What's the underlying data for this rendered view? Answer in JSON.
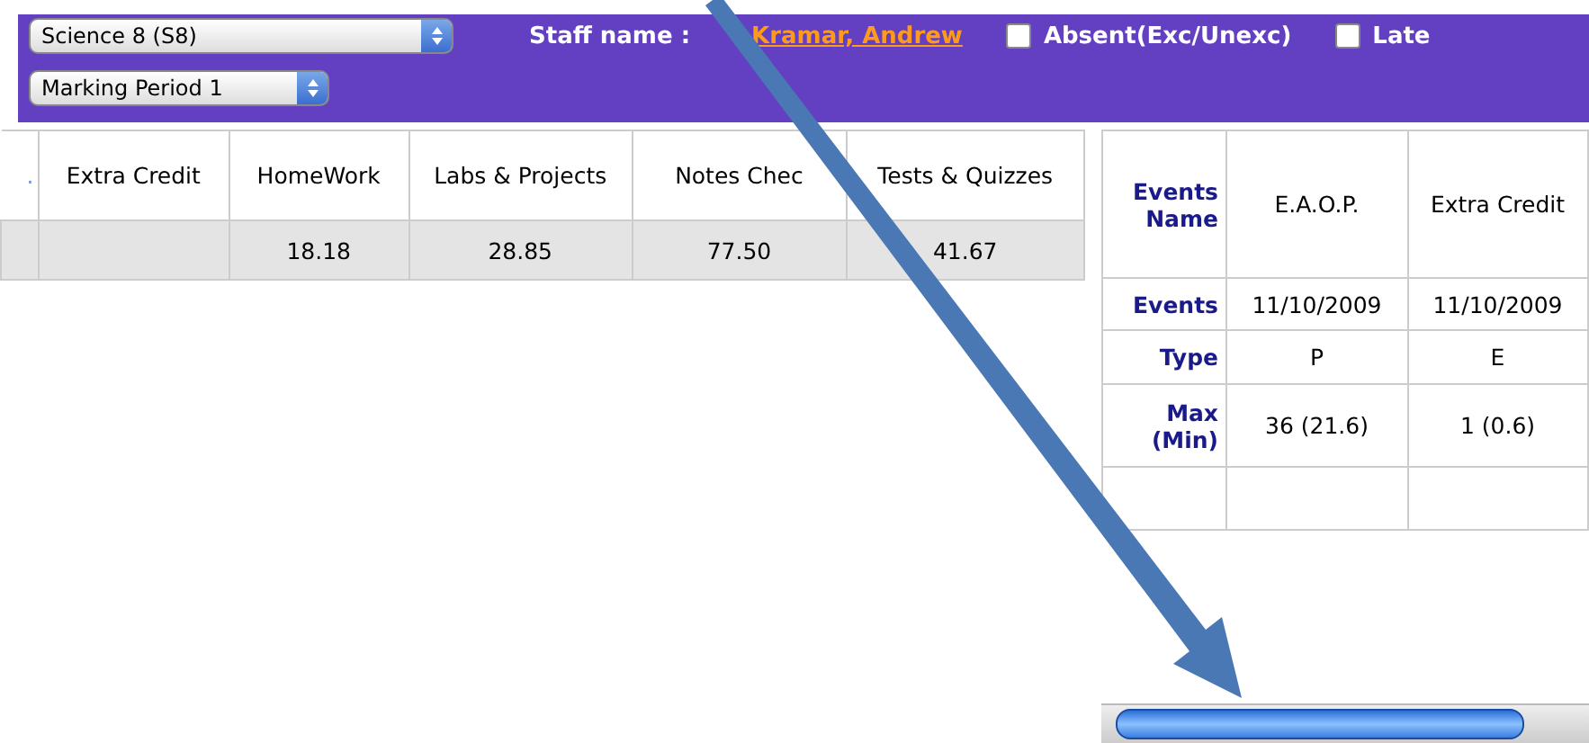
{
  "toolbar": {
    "course_select": {
      "value": "Science 8 (S8)"
    },
    "period_select": {
      "value": "Marking Period 1"
    },
    "staff_label": "Staff name :",
    "staff_name": "Kramar, Andrew",
    "checkboxes": [
      {
        "label": "Absent(Exc/Unexc)",
        "checked": false
      },
      {
        "label": "Late",
        "checked": false
      }
    ]
  },
  "scores_table": {
    "columns": [
      ".",
      "Extra Credit",
      "HomeWork",
      "Labs & Projects",
      "Notes Chec",
      "Tests & Quizzes"
    ],
    "rows": [
      [
        "",
        "",
        "18.18",
        "28.85",
        "77.50",
        "41.67"
      ]
    ]
  },
  "events_table": {
    "row_labels": [
      "Events Name",
      "Events",
      "Type",
      "Max (Min)"
    ],
    "columns": [
      {
        "name": "E.A.O.P.",
        "date": "11/10/2009",
        "type": "P",
        "max": "36 (21.6)"
      },
      {
        "name": "Extra Credit",
        "date": "11/10/2009",
        "type": "E",
        "max": "1 (0.6)"
      }
    ]
  }
}
